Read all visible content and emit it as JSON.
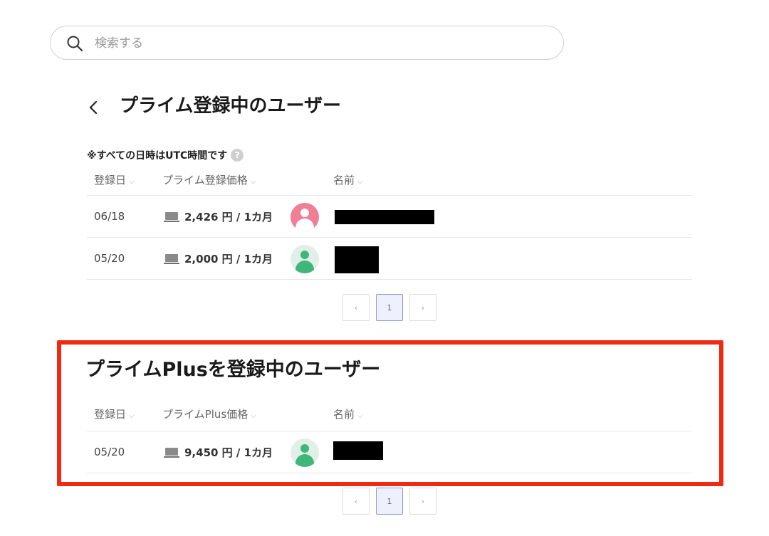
{
  "search": {
    "placeholder": "検索する",
    "value": ""
  },
  "section1": {
    "title": "プライム登録中のユーザー",
    "note": "※すべての日時はUTC時間です",
    "columns": {
      "date": "登録日",
      "price": "プライム登録価格",
      "name": "名前"
    },
    "rows": [
      {
        "date": "06/18",
        "price": "2,426 円 / 1カ月",
        "avatar": "pink"
      },
      {
        "date": "05/20",
        "price": "2,000 円 / 1カ月",
        "avatar": "green"
      }
    ],
    "pagination": {
      "prev": "‹",
      "page": "1",
      "next": "›"
    }
  },
  "section2": {
    "title": "プライムPlusを登録中のユーザー",
    "columns": {
      "date": "登録日",
      "price": "プライムPlus価格",
      "name": "名前"
    },
    "rows": [
      {
        "date": "05/20",
        "price": "9,450 円 / 1カ月",
        "avatar": "green"
      }
    ],
    "pagination": {
      "prev": "‹",
      "page": "1",
      "next": "›"
    }
  },
  "icons": [
    "search-icon",
    "back-chevron-icon",
    "help-icon",
    "laptop-icon",
    "user-avatar-icon",
    "sort-chevron-down-icon"
  ],
  "colors": {
    "highlight": "#ee2a14",
    "avatar_pink": "#f07e95",
    "avatar_green": "#3fb67a",
    "active_page": "#8d97d8"
  }
}
